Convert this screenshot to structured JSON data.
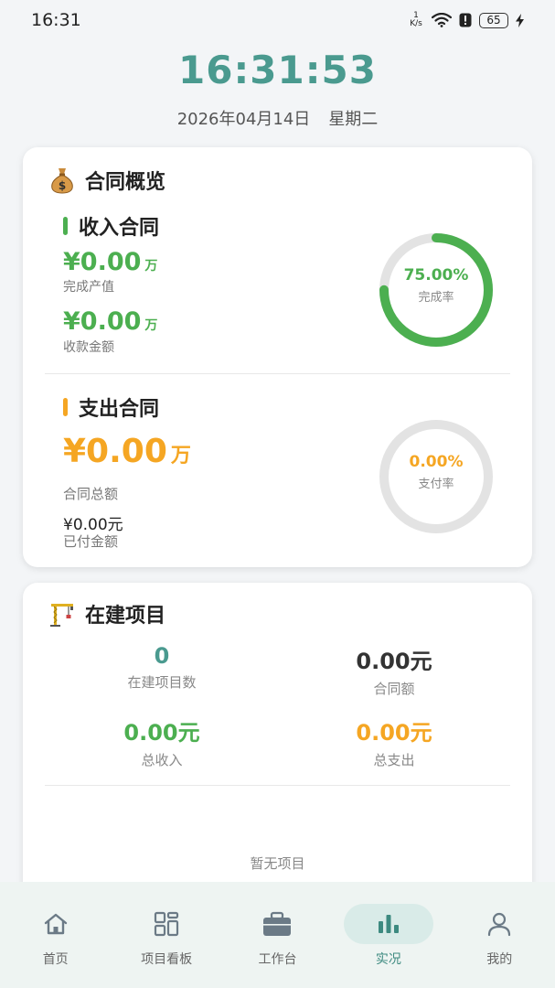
{
  "status_bar": {
    "time": "16:31",
    "net_speed_value": "1",
    "net_speed_unit": "K/s",
    "battery": "65"
  },
  "clock": {
    "time": "16:31:53",
    "date": "2026年04月14日",
    "weekday": "星期二"
  },
  "contract_overview": {
    "title": "合同概览",
    "icon": "money-bag-icon",
    "income": {
      "title": "收入合同",
      "output_value": "¥0.00",
      "output_unit": "万",
      "output_label": "完成产值",
      "collected_value": "¥0.00",
      "collected_unit": "万",
      "collected_label": "收款金额",
      "rate": "75.00%",
      "rate_fraction": 0.75,
      "rate_label": "完成率",
      "color": "#4caf50"
    },
    "expense": {
      "title": "支出合同",
      "total_value": "¥0.00",
      "total_unit": "万",
      "total_label": "合同总额",
      "paid_value": "¥0.00元",
      "paid_label": "已付金额",
      "rate": "0.00%",
      "rate_fraction": 0,
      "rate_label": "支付率",
      "color": "#f5a623"
    }
  },
  "projects": {
    "title": "在建项目",
    "icon": "crane-icon",
    "stats": [
      {
        "value": "0",
        "label": "在建项目数",
        "color": "#4a9a8f"
      },
      {
        "value": "0.00元",
        "label": "合同额",
        "color": "#333333"
      },
      {
        "value": "0.00元",
        "label": "总收入",
        "color": "#4caf50"
      },
      {
        "value": "0.00元",
        "label": "总支出",
        "color": "#f5a623"
      }
    ],
    "empty_text": "暂无项目"
  },
  "nav": {
    "items": [
      {
        "label": "首页",
        "icon": "home-icon"
      },
      {
        "label": "项目看板",
        "icon": "grid-icon"
      },
      {
        "label": "工作台",
        "icon": "briefcase-icon"
      },
      {
        "label": "实况",
        "icon": "bar-chart-icon"
      },
      {
        "label": "我的",
        "icon": "user-icon"
      }
    ],
    "active_index": 3
  }
}
